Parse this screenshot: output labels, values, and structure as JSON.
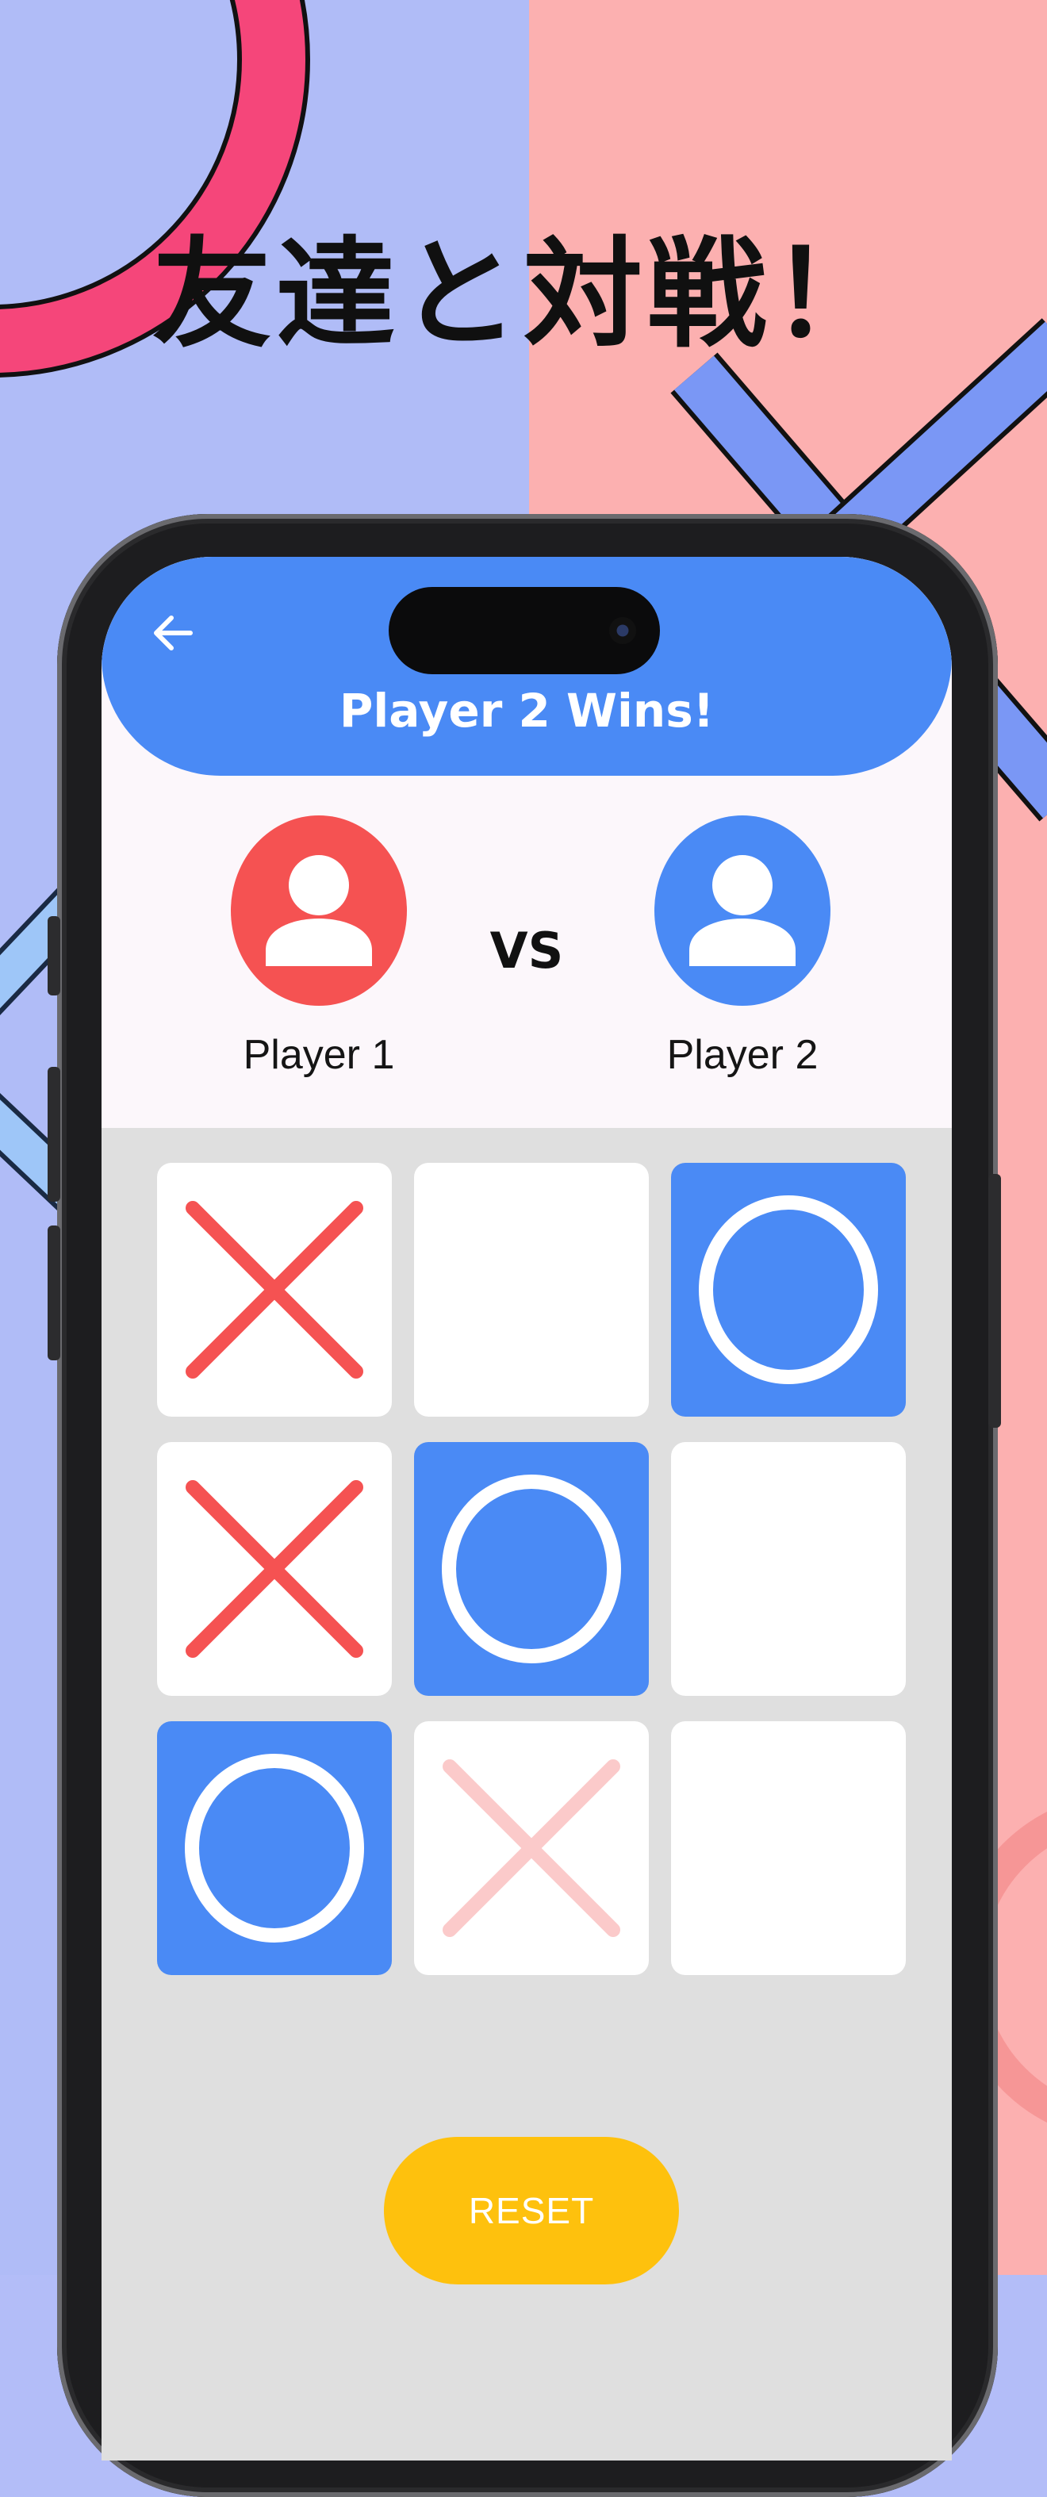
{
  "promo": {
    "headline": "友達と対戦！"
  },
  "app": {
    "title": "Player 2 Wins!",
    "back_icon": "arrow-left-icon",
    "players": [
      {
        "name": "Player 1",
        "color": "#f55252",
        "icon": "person-icon"
      },
      {
        "name": "Player 2",
        "color": "#4a8af5",
        "icon": "person-icon"
      }
    ],
    "vs_label": "VS",
    "board": [
      [
        "X",
        "",
        "O"
      ],
      [
        "X",
        "O",
        ""
      ],
      [
        "O",
        "X-faded",
        ""
      ]
    ],
    "reset_label": "RESET"
  },
  "colors": {
    "x_mark": "#f55252",
    "o_cell": "#4a8af5",
    "app_bar": "#4a8af5",
    "reset_button": "#fec10d",
    "background_left": "#b0bcf7",
    "background_right": "#fcb0b0"
  }
}
